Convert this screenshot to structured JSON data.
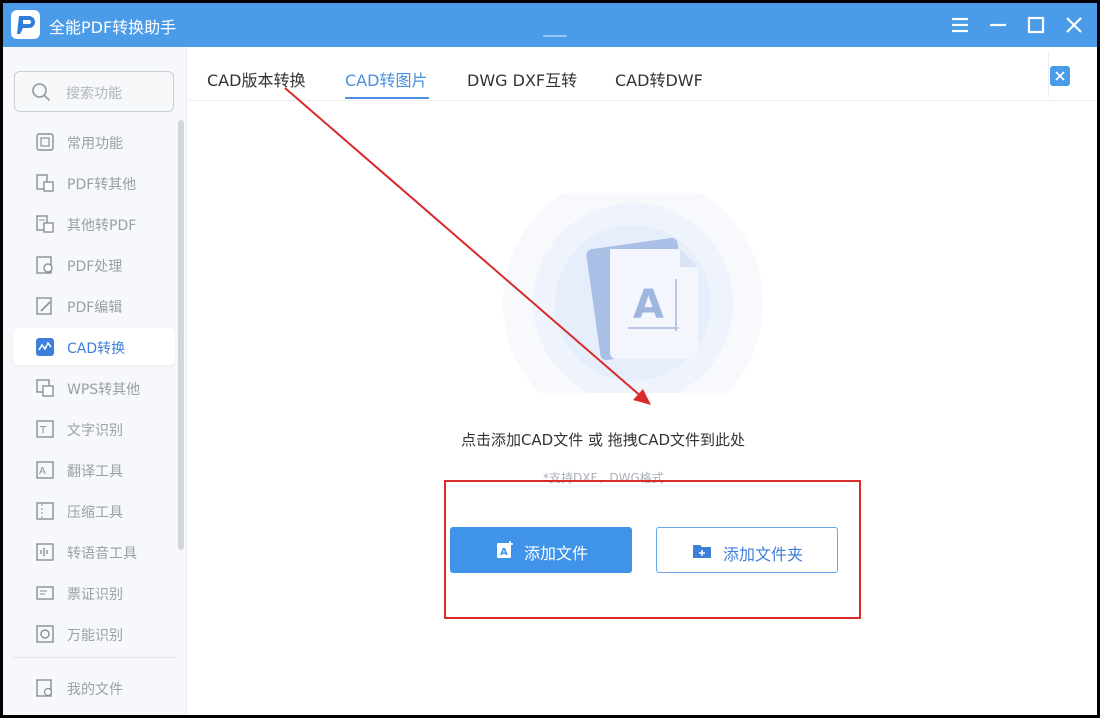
{
  "app": {
    "title": "全能PDF转换助手",
    "accent_color": "#4a9be8",
    "window_controls": [
      "menu-icon",
      "minimize-icon",
      "maximize-icon",
      "close-icon"
    ]
  },
  "sidebar": {
    "search_placeholder": "搜索功能",
    "items": [
      {
        "label": "常用功能",
        "icon": "common-functions-icon",
        "active": false
      },
      {
        "label": "PDF转其他",
        "icon": "pdf-to-other-icon",
        "active": false
      },
      {
        "label": "其他转PDF",
        "icon": "other-to-pdf-icon",
        "active": false
      },
      {
        "label": "PDF处理",
        "icon": "pdf-process-icon",
        "active": false
      },
      {
        "label": "PDF编辑",
        "icon": "pdf-edit-icon",
        "active": false
      },
      {
        "label": "CAD转换",
        "icon": "cad-convert-icon",
        "active": true
      },
      {
        "label": "WPS转其他",
        "icon": "wps-to-other-icon",
        "active": false
      },
      {
        "label": "文字识别",
        "icon": "text-recognition-icon",
        "active": false
      },
      {
        "label": "翻译工具",
        "icon": "translate-icon",
        "active": false
      },
      {
        "label": "压缩工具",
        "icon": "compress-icon",
        "active": false
      },
      {
        "label": "转语音工具",
        "icon": "to-speech-icon",
        "active": false
      },
      {
        "label": "票证识别",
        "icon": "ticket-recognition-icon",
        "active": false
      },
      {
        "label": "万能识别",
        "icon": "universal-recognition-icon",
        "active": false
      }
    ],
    "my_files_label": "我的文件"
  },
  "tabs": [
    {
      "label": "CAD版本转换",
      "active": false
    },
    {
      "label": "CAD转图片",
      "active": true
    },
    {
      "label": "DWG DXF互转",
      "active": false
    },
    {
      "label": "CAD转DWF",
      "active": false
    }
  ],
  "main": {
    "drop_hint": "点击添加CAD文件 或 拖拽CAD文件到此处",
    "format_note": "*支持DXF、DWG格式",
    "add_file_label": "添加文件",
    "add_folder_label": "添加文件夹"
  },
  "annotations": {
    "highlight_color": "#d92b2b"
  }
}
